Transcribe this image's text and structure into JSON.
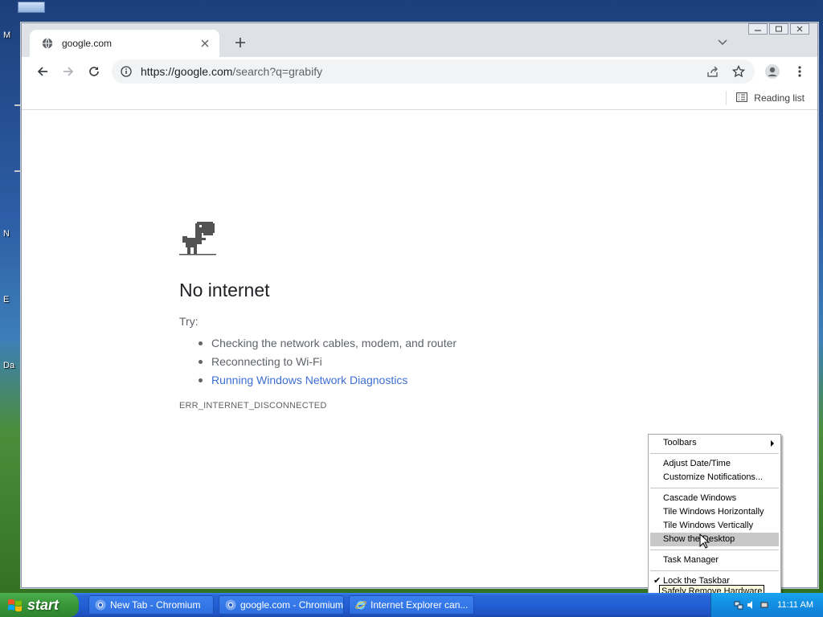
{
  "desktop": {
    "labels": [
      "M",
      "N",
      "E",
      "Da"
    ]
  },
  "browser": {
    "tab": {
      "title": "google.com",
      "favicon": "globe-icon"
    },
    "toolbar": {
      "url_host": "https://google.com",
      "url_path": "/search?q=grabify"
    },
    "bookmarkbar": {
      "reading_list_label": "Reading list"
    },
    "error_page": {
      "title": "No internet",
      "try_label": "Try:",
      "suggestions": [
        "Checking the network cables, modem, and router",
        "Reconnecting to Wi-Fi",
        "Running Windows Network Diagnostics"
      ],
      "error_code": "ERR_INTERNET_DISCONNECTED"
    }
  },
  "context_menu": {
    "items": [
      "Toolbars",
      "Adjust Date/Time",
      "Customize Notifications...",
      "Cascade Windows",
      "Tile Windows Horizontally",
      "Tile Windows Vertically",
      "Show the Desktop",
      "Task Manager",
      "Lock the Taskbar"
    ],
    "tooltip": "Safely Remove Hardware"
  },
  "taskbar": {
    "start_label": "start",
    "tasks": [
      "New Tab - Chromium",
      "google.com - Chromium",
      "Internet Explorer can..."
    ],
    "clock": "11:11 AM"
  },
  "colors": {
    "link": "#3c6fd1",
    "taskbar": "#235fd6",
    "start": "#3c9a3c"
  }
}
